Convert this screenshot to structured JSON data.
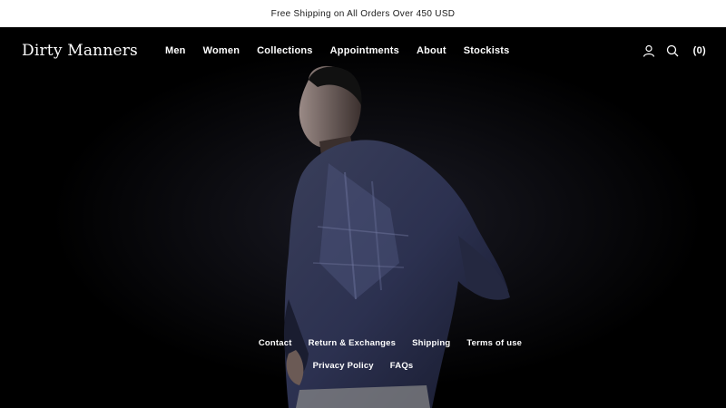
{
  "announcement": "Free Shipping on All Orders Over 450 USD",
  "header": {
    "logo": "Dirty Manners",
    "nav": [
      "Men",
      "Women",
      "Collections",
      "Appointments",
      "About",
      "Stockists"
    ],
    "icons": [
      "account-icon",
      "search-icon"
    ],
    "cart_label": "(0)"
  },
  "footer": {
    "row1": [
      "Contact",
      "Return & Exchanges",
      "Shipping",
      "Terms of use"
    ],
    "row2": [
      "Privacy Policy",
      "FAQs"
    ]
  }
}
